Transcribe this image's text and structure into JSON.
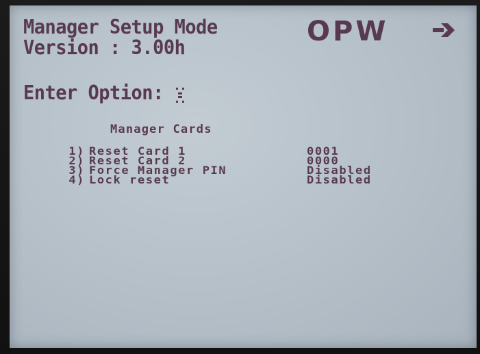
{
  "header": {
    "title_line1": "Manager Setup Mode",
    "title_line2": "Version : 3.00h"
  },
  "prompt": {
    "label": "Enter Option:"
  },
  "logo": {
    "text": "OPW",
    "icon": "arrow-right-icon",
    "color": "#583a4f"
  },
  "section": {
    "title": "Manager Cards"
  },
  "menu": {
    "items": [
      {
        "number": "1)",
        "label": "Reset Card 1",
        "value": "0001"
      },
      {
        "number": "2)",
        "label": "Reset Card 2",
        "value": "0000"
      },
      {
        "number": "3)",
        "label": "Force Manager PIN",
        "value": "Disabled"
      },
      {
        "number": "4)",
        "label": "Lock reset",
        "value": "Disabled"
      }
    ]
  },
  "colors": {
    "text": "#583a4f",
    "screen": "#b8c2cb",
    "bezel": "#141414"
  }
}
